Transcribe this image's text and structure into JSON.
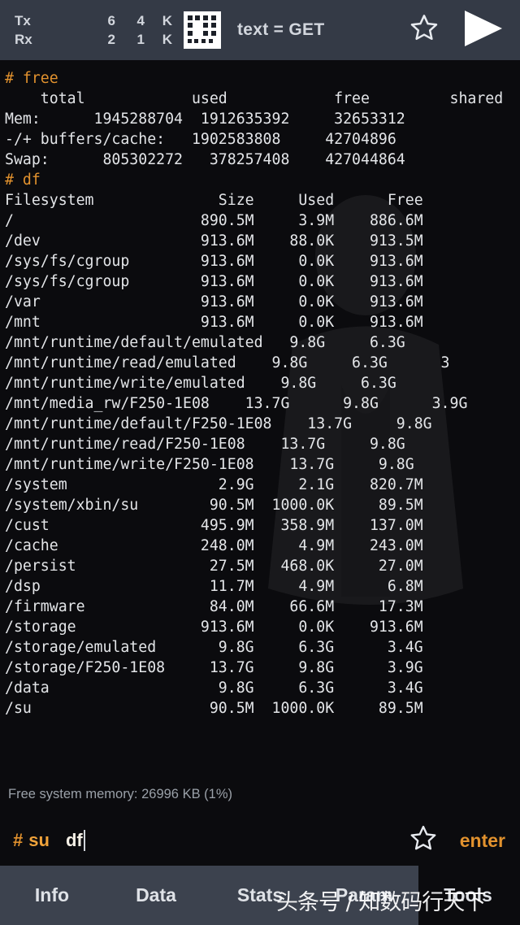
{
  "header": {
    "tx_label": "Tx",
    "rx_label": "Rx",
    "tx_count": "6",
    "rx_count": "2",
    "tx_rate": "4",
    "rx_rate": "1",
    "tx_unit": "K",
    "rx_unit": "K",
    "mode_label": "text = GET",
    "star_icon": "star-outline-icon",
    "play_icon": "play-triangle-icon",
    "qr_icon": "qr-grid-icon",
    "bg_color": "#343a46"
  },
  "terminal": {
    "prompt_color": "#e2922e",
    "text_color": "#e3e5e8",
    "bg_color": "#0b0b0e",
    "lines": [
      {
        "type": "cmd",
        "text": "# free"
      },
      {
        "type": "out",
        "text": "    total            used            free         shared        bu"
      },
      {
        "type": "out",
        "text": "Mem:      1945288704  1912635392     32653312              "
      },
      {
        "type": "out",
        "text": "-/+ buffers/cache:   1902583808     42704896"
      },
      {
        "type": "out",
        "text": "Swap:      805302272   378257408    427044864"
      },
      {
        "type": "cmd",
        "text": "# df"
      },
      {
        "type": "out",
        "text": "Filesystem              Size     Used      Free     "
      },
      {
        "type": "out",
        "text": "/                     890.5M     3.9M    886.6M     "
      },
      {
        "type": "out",
        "text": "/dev                  913.6M    88.0K    913.5M     "
      },
      {
        "type": "out",
        "text": "/sys/fs/cgroup        913.6M     0.0K    913.6M     "
      },
      {
        "type": "out",
        "text": "/sys/fs/cgroup        913.6M     0.0K    913.6M     "
      },
      {
        "type": "out",
        "text": "/var                  913.6M     0.0K    913.6M     "
      },
      {
        "type": "out",
        "text": "/mnt                  913.6M     0.0K    913.6M     "
      },
      {
        "type": "out",
        "text": "/mnt/runtime/default/emulated   9.8G     6.3G"
      },
      {
        "type": "out",
        "text": "/mnt/runtime/read/emulated    9.8G     6.3G      3"
      },
      {
        "type": "out",
        "text": "/mnt/runtime/write/emulated    9.8G     6.3G"
      },
      {
        "type": "out",
        "text": "/mnt/media_rw/F250-1E08    13.7G      9.8G      3.9G"
      },
      {
        "type": "out",
        "text": "/mnt/runtime/default/F250-1E08    13.7G     9.8G"
      },
      {
        "type": "out",
        "text": "/mnt/runtime/read/F250-1E08    13.7G     9.8G     "
      },
      {
        "type": "out",
        "text": "/mnt/runtime/write/F250-1E08    13.7G     9.8G"
      },
      {
        "type": "out",
        "text": "/system                 2.9G     2.1G    820.7M    "
      },
      {
        "type": "out",
        "text": "/system/xbin/su        90.5M  1000.0K     89.5M    "
      },
      {
        "type": "out",
        "text": "/cust                 495.9M   358.9M    137.0M    "
      },
      {
        "type": "out",
        "text": "/cache                248.0M     4.9M    243.0M    "
      },
      {
        "type": "out",
        "text": "/persist               27.5M   468.0K     27.0M    "
      },
      {
        "type": "out",
        "text": "/dsp                   11.7M     4.9M      6.8M    "
      },
      {
        "type": "out",
        "text": "/firmware              84.0M    66.6M     17.3M"
      },
      {
        "type": "out",
        "text": "/storage              913.6M     0.0K    913.6M    "
      },
      {
        "type": "out",
        "text": "/storage/emulated       9.8G     6.3G      3.4G    "
      },
      {
        "type": "out",
        "text": "/storage/F250-1E08     13.7G     9.8G      3.9G    "
      },
      {
        "type": "out",
        "text": "/data                   9.8G     6.3G      3.4G    "
      },
      {
        "type": "out",
        "text": "/su                    90.5M  1000.0K     89.5M    "
      }
    ]
  },
  "status": {
    "memory_text": "Free system memory: 26996 KB  (1%)"
  },
  "input": {
    "prompt_hash": "#",
    "prompt_user": "su",
    "command_value": "df",
    "star_icon": "star-outline-icon",
    "enter_label": "enter"
  },
  "tabs": [
    {
      "label": "Info"
    },
    {
      "label": "Data"
    },
    {
      "label": "Stats"
    },
    {
      "label": "Param"
    },
    {
      "label": "Tools"
    }
  ],
  "watermark": {
    "text": "头条号 / 知数码行天下"
  }
}
